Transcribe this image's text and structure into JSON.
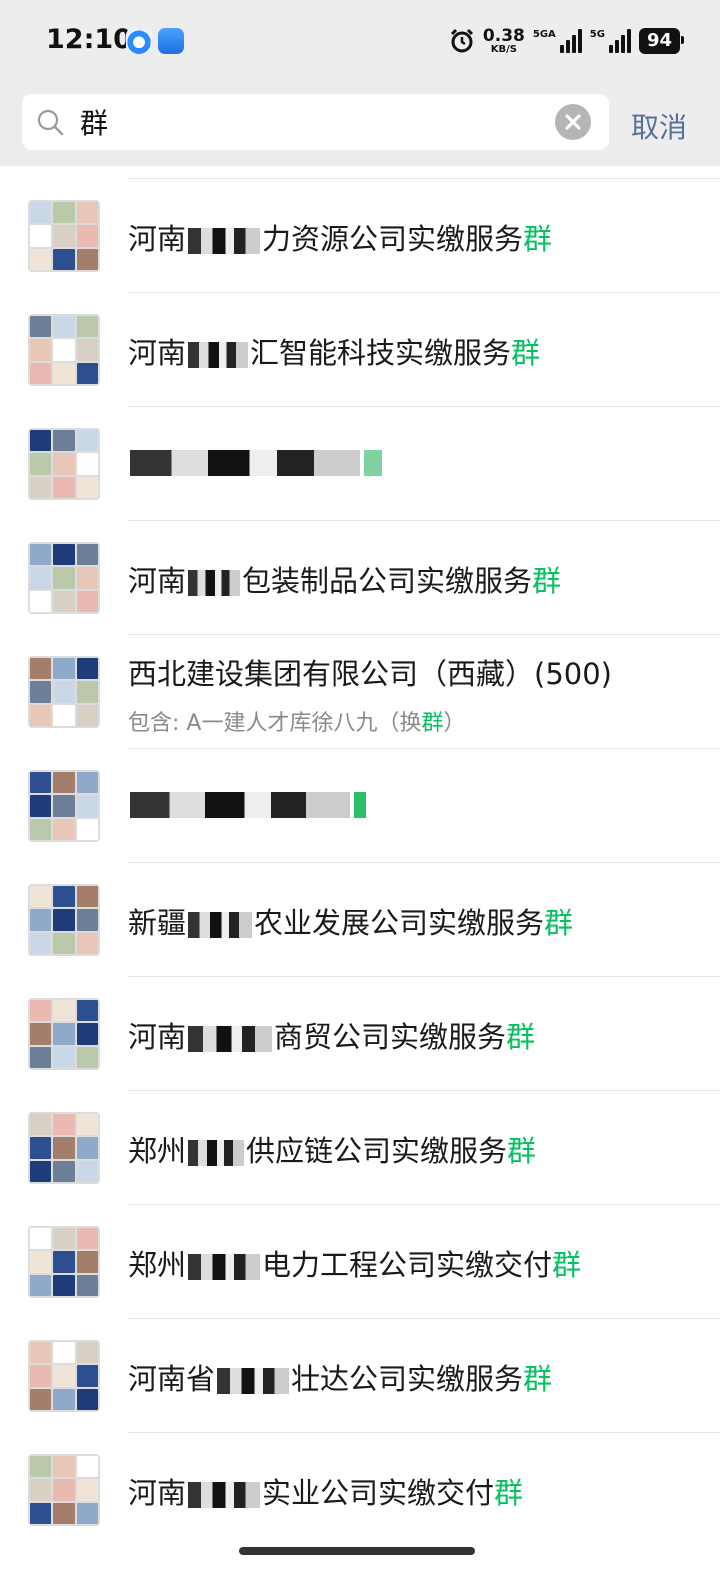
{
  "status_bar": {
    "time": "12:10",
    "net_speed": "0.38",
    "net_speed_unit": "KB/S",
    "signal1_tag": "5GA",
    "signal2_tag": "5G",
    "battery": "94"
  },
  "search": {
    "query": "群",
    "cancel_label": "取消"
  },
  "results": [
    {
      "prefix": "河南",
      "suffix": "力资源公司实缴服务",
      "highlight": "群"
    },
    {
      "prefix": "河南",
      "suffix": "汇智能科技实缴服务",
      "highlight": "群"
    },
    {
      "prefix": "",
      "suffix": "",
      "highlight": ""
    },
    {
      "prefix": "河南",
      "suffix": "包装制品公司实缴服务",
      "highlight": "群"
    },
    {
      "title": "西北建设集团有限公司（西藏）(500)",
      "sub_prefix": "包含: A一建人才库徐八九（换",
      "sub_highlight": "群",
      "sub_suffix": "）"
    },
    {
      "prefix": "",
      "suffix": "",
      "highlight": ""
    },
    {
      "prefix": "新疆",
      "suffix": "农业发展公司实缴服务",
      "highlight": "群"
    },
    {
      "prefix": "河南",
      "suffix": "商贸公司实缴服务",
      "highlight": "群"
    },
    {
      "prefix": "郑州",
      "suffix": "供应链公司实缴服务",
      "highlight": "群"
    },
    {
      "prefix": "郑州",
      "suffix": "电力工程公司实缴交付",
      "highlight": "群"
    },
    {
      "prefix": "河南省",
      "suffix": "壮达公司实缴服务",
      "highlight": "群"
    },
    {
      "prefix": "河南",
      "suffix": "实业公司实缴交付",
      "highlight": "群"
    }
  ],
  "colors": {
    "accent_green": "#07c160",
    "cancel_blue": "#586f97",
    "header_bg": "#ededed"
  },
  "icons": [
    "search-icon",
    "clear-icon",
    "alarm-icon",
    "signal-icon",
    "battery-icon"
  ]
}
